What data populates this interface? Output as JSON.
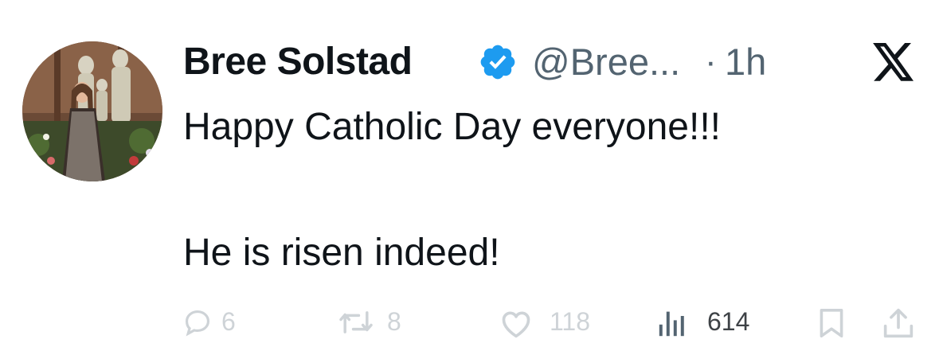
{
  "tweet": {
    "display_name": "Bree Solstad",
    "handle": "@Bree...",
    "separator": "·",
    "time": "1h",
    "text_line_1": "Happy Catholic Day everyone!!!",
    "text_line_2": "He is risen indeed!"
  },
  "actions": {
    "replies": "6",
    "reposts": "8",
    "likes": "118",
    "views": "614"
  },
  "icons": {
    "verified": "verified-badge-icon",
    "platform": "x-logo-icon",
    "reply": "reply-icon",
    "repost": "repost-icon",
    "like": "heart-icon",
    "views": "views-chart-icon",
    "bookmark": "bookmark-icon",
    "share": "share-icon"
  },
  "colors": {
    "text": "#0f1419",
    "secondary": "#536471",
    "verified": "#1d9bf0"
  }
}
